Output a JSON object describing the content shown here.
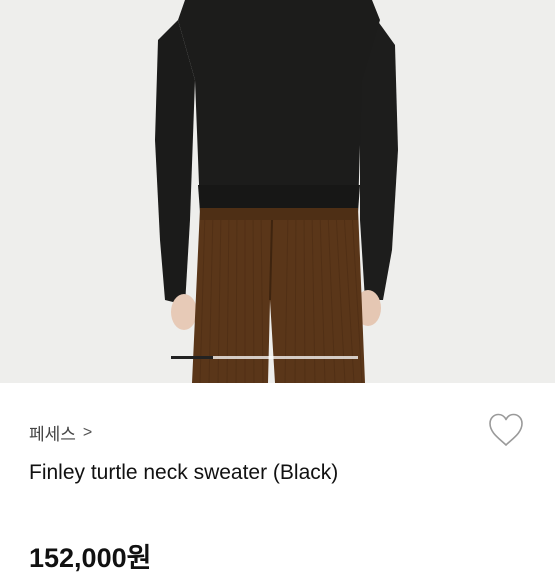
{
  "product": {
    "brand_label": "페세스",
    "brand_chevron": ">",
    "title": "Finley turtle neck sweater (Black)",
    "price": "152,000원"
  },
  "gallery": {
    "image_alt": "model wearing black turtle neck sweater with brown corduroy pants",
    "active_slide": 1
  },
  "icons": {
    "like": "heart-outline-icon",
    "brand_link": "chevron-right-icon"
  },
  "colors": {
    "sweater": "#1b1b1a",
    "pants": "#5a3619",
    "pager_active": "#222222"
  }
}
